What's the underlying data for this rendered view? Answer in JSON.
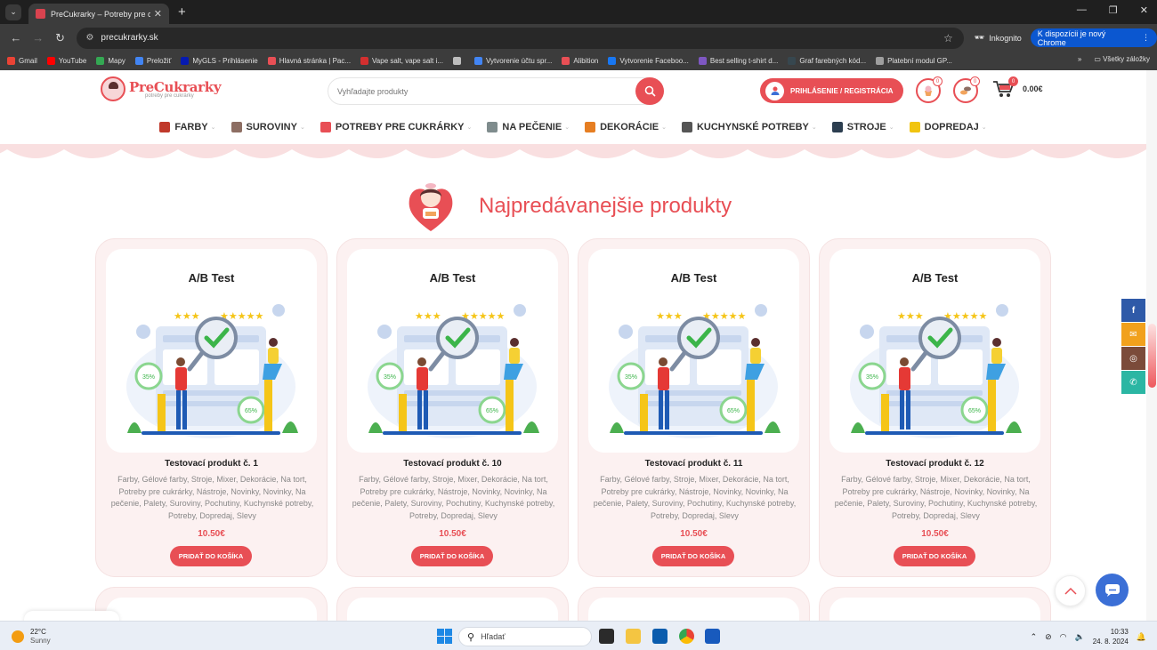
{
  "browser": {
    "tab_title": "PreCukrarky – Potreby pre cukrárky",
    "url": "precukrarky.sk",
    "incognito_label": "Inkognito",
    "new_chrome_label": "K dispozícii je nový Chrome",
    "bookmarks": [
      {
        "label": "Gmail",
        "color": "#ea4335"
      },
      {
        "label": "YouTube",
        "color": "#ff0000"
      },
      {
        "label": "Mapy",
        "color": "#34a853"
      },
      {
        "label": "Preložiť",
        "color": "#4285f4"
      },
      {
        "label": "MyGLS - Prihlásenie",
        "color": "#061ab1"
      },
      {
        "label": "Hlavná stránka | Pac...",
        "color": "#e84f55"
      },
      {
        "label": "Vape salt, vape salt i...",
        "color": "#d32f2f"
      },
      {
        "label": "",
        "color": "#bdbdbd"
      },
      {
        "label": "Vytvorenie účtu spr...",
        "color": "#4285f4"
      },
      {
        "label": "Alibition",
        "color": "#e84f55"
      },
      {
        "label": "Vytvorenie Faceboo...",
        "color": "#1877f2"
      },
      {
        "label": "Best selling t-shirt d...",
        "color": "#7e57c2"
      },
      {
        "label": "Graf farebných kód...",
        "color": "#37474f"
      },
      {
        "label": "Platební modul GP...",
        "color": "#9e9e9e"
      }
    ],
    "all_bookmarks_label": "Všetky záložky"
  },
  "site": {
    "logo_text": "PreCukrarky",
    "logo_tagline": "potreby pre cukrárky",
    "search_placeholder": "Vyhľadajte produkty",
    "login_label": "PRIHLÁSENIE / REGISTRÁCIA",
    "wishlist_count": "0",
    "compare_count": "0",
    "cart_count": "0",
    "cart_total": "0.00€",
    "menu": [
      {
        "label": "FARBY",
        "color": "#c0392b"
      },
      {
        "label": "SUROVINY",
        "color": "#8d6e63"
      },
      {
        "label": "POTREBY PRE CUKRÁRKY",
        "color": "#e84f55"
      },
      {
        "label": "NA PEČENIE",
        "color": "#7f8c8d"
      },
      {
        "label": "DEKORÁCIE",
        "color": "#e67e22"
      },
      {
        "label": "KUCHYNSKÉ POTREBY",
        "color": "#555"
      },
      {
        "label": "STROJE",
        "color": "#2c3e50"
      },
      {
        "label": "DOPREDAJ",
        "color": "#f1c40f"
      }
    ],
    "section_title": "Najpredávanejšie produkty",
    "products": [
      {
        "image_title": "A/B Test",
        "name": "Testovací produkt č. 1",
        "categories": "Farby, Gélové farby, Stroje, Mixer, Dekorácie, Na tort, Potreby pre cukrárky, Nástroje, Novinky, Novinky, Na pečenie, Palety, Suroviny, Pochutiny, Kuchynské potreby, Potreby, Dopredaj, Slevy",
        "price": "10.50€",
        "button": "PRIDAŤ DO KOŠÍKA"
      },
      {
        "image_title": "A/B Test",
        "name": "Testovací produkt č. 10",
        "categories": "Farby, Gélové farby, Stroje, Mixer, Dekorácie, Na tort, Potreby pre cukrárky, Nástroje, Novinky, Novinky, Na pečenie, Palety, Suroviny, Pochutiny, Kuchynské potreby, Potreby, Dopredaj, Slevy",
        "price": "10.50€",
        "button": "PRIDAŤ DO KOŠÍKA"
      },
      {
        "image_title": "A/B Test",
        "name": "Testovací produkt č. 11",
        "categories": "Farby, Gélové farby, Stroje, Mixer, Dekorácie, Na tort, Potreby pre cukrárky, Nástroje, Novinky, Novinky, Na pečenie, Palety, Suroviny, Pochutiny, Kuchynské potreby, Potreby, Dopredaj, Slevy",
        "price": "10.50€",
        "button": "PRIDAŤ DO KOŠÍKA"
      },
      {
        "image_title": "A/B Test",
        "name": "Testovací produkt č. 12",
        "categories": "Farby, Gélové farby, Stroje, Mixer, Dekorácie, Na tort, Potreby pre cukrárky, Nástroje, Novinky, Novinky, Na pečenie, Palety, Suroviny, Pochutiny, Kuchynské potreby, Potreby, Dopredaj, Slevy",
        "price": "10.50€",
        "button": "PRIDAŤ DO KOŠÍKA"
      }
    ],
    "social": [
      {
        "icon": "facebook-icon",
        "glyph": "f",
        "color": "#2f5aa8"
      },
      {
        "icon": "email-icon",
        "glyph": "✉",
        "color": "#f1a11d"
      },
      {
        "icon": "instagram-icon",
        "glyph": "◎",
        "color": "#7b4b3a"
      },
      {
        "icon": "whatsapp-icon",
        "glyph": "✆",
        "color": "#2bb6a3"
      }
    ],
    "accent_color": "#e84f55"
  },
  "taskbar": {
    "temperature": "22°C",
    "weather": "Sunny",
    "search_label": "Hľadať",
    "time": "10:33",
    "date": "24. 8. 2024"
  }
}
